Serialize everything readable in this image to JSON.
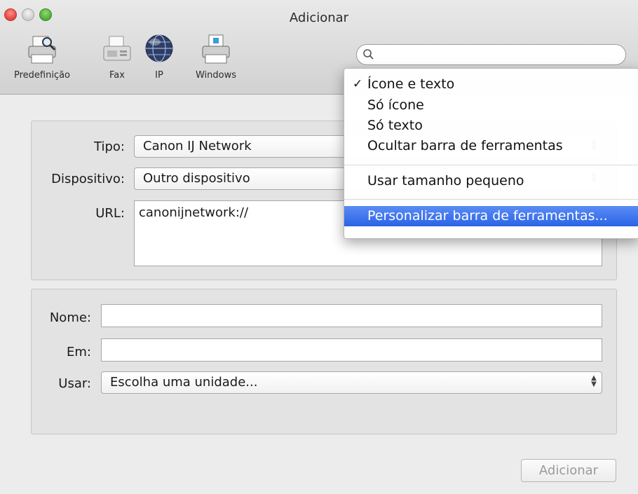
{
  "window": {
    "title": "Adicionar"
  },
  "toolbar": {
    "items": [
      {
        "label": "Predefinição",
        "icon": "printer-magnifier-icon"
      },
      {
        "label": "Fax",
        "icon": "fax-icon"
      },
      {
        "label": "IP",
        "icon": "globe-icon"
      },
      {
        "label": "Windows",
        "icon": "windows-printer-icon"
      }
    ],
    "search_placeholder": ""
  },
  "printer": {
    "type_label": "Tipo:",
    "type_value": "Canon IJ Network",
    "device_label": "Dispositivo:",
    "device_value": "Outro dispositivo",
    "url_label": "URL:",
    "url_value": "canonijnetwork://"
  },
  "details": {
    "name_label": "Nome:",
    "name_value": "",
    "location_label": "Em:",
    "location_value": "",
    "use_label": "Usar:",
    "use_value": "Escolha uma unidade..."
  },
  "footer": {
    "add_label": "Adicionar"
  },
  "context_menu": {
    "items": [
      {
        "label": "Ícone e texto",
        "checked": true
      },
      {
        "label": "Só ícone"
      },
      {
        "label": "Só texto"
      },
      {
        "label": "Ocultar barra de ferramentas"
      },
      {
        "label": "Usar tamanho pequeno"
      },
      {
        "label": "Personalizar barra de ferramentas...",
        "highlighted": true
      }
    ],
    "check_mark": "✓"
  },
  "colors": {
    "highlight": "#2a64e6",
    "close": "#e0443e",
    "zoom": "#4ea937"
  }
}
